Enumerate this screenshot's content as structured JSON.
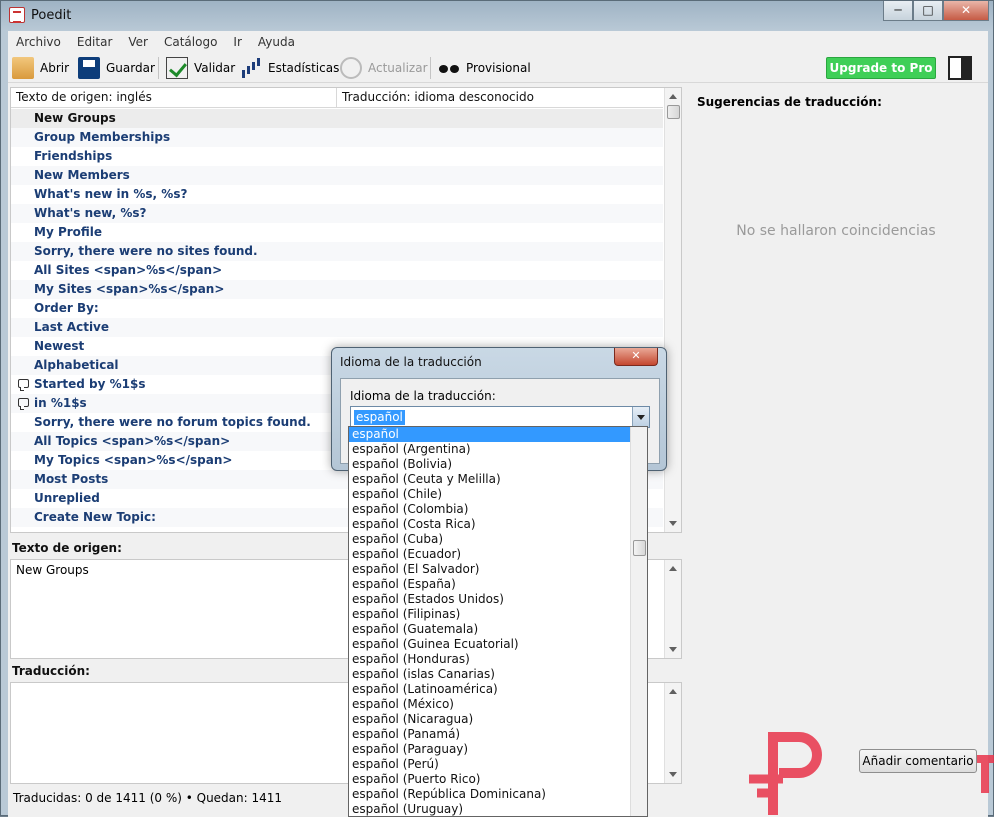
{
  "window": {
    "title": "Poedit",
    "controls": {
      "minimize": "─",
      "maximize": "□",
      "close": "✕"
    }
  },
  "menu": [
    "Archivo",
    "Editar",
    "Ver",
    "Catálogo",
    "Ir",
    "Ayuda"
  ],
  "toolbar": {
    "open": "Abrir",
    "save": "Guardar",
    "validate": "Validar",
    "stats": "Estadísticas",
    "update": "Actualizar",
    "fuzzy": "Provisional",
    "upgrade": "Upgrade to Pro",
    "icons": [
      "folder-icon",
      "floppy-disk-icon",
      "checkmark-icon",
      "bar-chart-icon",
      "refresh-icon",
      "glasses-icon",
      "sidebar-toggle-icon"
    ]
  },
  "list": {
    "source_header": "Texto de origen: inglés",
    "translation_header": "Traducción: idioma desconocido",
    "rows": [
      {
        "text": "New Groups",
        "comment": false
      },
      {
        "text": "Group Memberships",
        "comment": false
      },
      {
        "text": "Friendships",
        "comment": false
      },
      {
        "text": "New Members",
        "comment": false
      },
      {
        "text": "What's new in %s, %s?",
        "comment": false
      },
      {
        "text": "What's new, %s?",
        "comment": false
      },
      {
        "text": "My Profile",
        "comment": false
      },
      {
        "text": "Sorry, there were no sites found.",
        "comment": false
      },
      {
        "text": "All Sites <span>%s</span>",
        "comment": false
      },
      {
        "text": "My Sites <span>%s</span>",
        "comment": false
      },
      {
        "text": "Order By:",
        "comment": false
      },
      {
        "text": "Last Active",
        "comment": false
      },
      {
        "text": "Newest",
        "comment": false
      },
      {
        "text": "Alphabetical",
        "comment": false
      },
      {
        "text": "Started by %1$s",
        "comment": true
      },
      {
        "text": "in %1$s",
        "comment": true
      },
      {
        "text": "Sorry, there were no forum topics found.",
        "comment": false
      },
      {
        "text": "All Topics <span>%s</span>",
        "comment": false
      },
      {
        "text": "My Topics <span>%s</span>",
        "comment": false
      },
      {
        "text": "Most Posts",
        "comment": false
      },
      {
        "text": "Unreplied",
        "comment": false
      },
      {
        "text": "Create New Topic:",
        "comment": false
      }
    ]
  },
  "source_section": {
    "label": "Texto de origen:",
    "text": "New Groups"
  },
  "translation_section": {
    "label": "Traducción:",
    "text": ""
  },
  "status": "Traducidas: 0 de 1411 (0 %)  •  Quedan: 1411",
  "sidebar": {
    "title": "Sugerencias de traducción:",
    "empty": "No se hallaron coincidencias",
    "comment_button": "Añadir comentario"
  },
  "dialog": {
    "title": "Idioma de la traducción",
    "close": "✕",
    "label": "Idioma de la traducción:",
    "value": "español",
    "options": [
      "español",
      "español (Argentina)",
      "español (Bolivia)",
      "español (Ceuta y Melilla)",
      "español (Chile)",
      "español (Colombia)",
      "español (Costa Rica)",
      "español (Cuba)",
      "español (Ecuador)",
      "español (El Salvador)",
      "español (España)",
      "español (Estados Unidos)",
      "español (Filipinas)",
      "español (Guatemala)",
      "español (Guinea Ecuatorial)",
      "español (Honduras)",
      "español (islas Canarias)",
      "español (Latinoamérica)",
      "español (México)",
      "español (Nicaragua)",
      "español (Panamá)",
      "español (Paraguay)",
      "español (Perú)",
      "español (Puerto Rico)",
      "español (República Dominicana)",
      "español (Uruguay)"
    ],
    "selected_index": 0
  },
  "watermark": {
    "color": "#e8344a"
  }
}
